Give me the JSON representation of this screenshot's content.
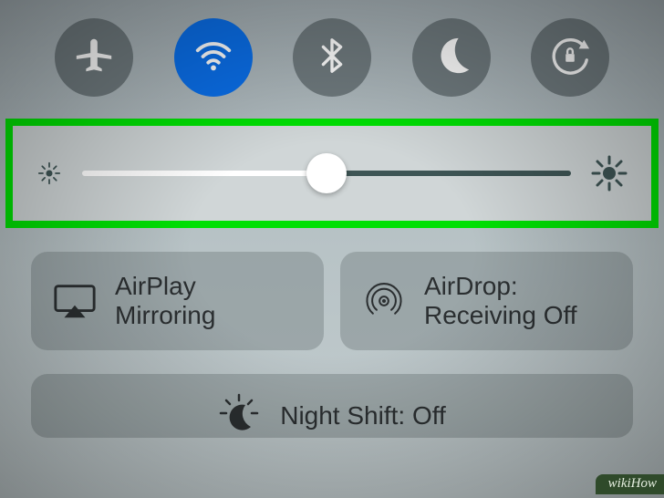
{
  "toggles": {
    "airplane": {
      "name": "airplane-mode",
      "active": false
    },
    "wifi": {
      "name": "wifi",
      "active": true
    },
    "bluetooth": {
      "name": "bluetooth",
      "active": false
    },
    "dnd": {
      "name": "do-not-disturb",
      "active": false
    },
    "lock": {
      "name": "rotation-lock",
      "active": false
    }
  },
  "brightness": {
    "value_percent": 50
  },
  "actions": {
    "airplay": {
      "line1": "AirPlay",
      "line2": "Mirroring"
    },
    "airdrop": {
      "line1": "AirDrop:",
      "line2": "Receiving Off"
    }
  },
  "night_shift": {
    "label": "Night Shift: Off"
  },
  "watermark": "wikiHow",
  "colors": {
    "toggle_off": "#6f7a7e",
    "toggle_on": "#0a6ee8",
    "highlight": "#00e003",
    "panel": "#d0d6d7",
    "action_bg": "rgba(130,140,142,0.55)"
  }
}
